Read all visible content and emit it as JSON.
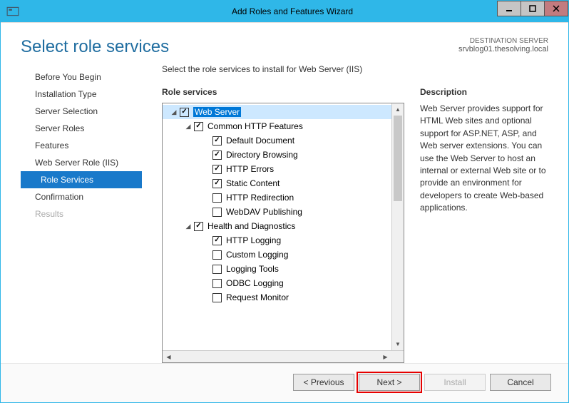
{
  "window": {
    "title": "Add Roles and Features Wizard"
  },
  "header": {
    "page_title": "Select role services",
    "dest_label": "DESTINATION SERVER",
    "dest_value": "srvblog01.thesolving.local"
  },
  "nav": {
    "items": [
      {
        "label": "Before You Begin",
        "state": "normal"
      },
      {
        "label": "Installation Type",
        "state": "normal"
      },
      {
        "label": "Server Selection",
        "state": "normal"
      },
      {
        "label": "Server Roles",
        "state": "normal"
      },
      {
        "label": "Features",
        "state": "normal"
      },
      {
        "label": "Web Server Role (IIS)",
        "state": "normal"
      },
      {
        "label": "Role Services",
        "state": "active"
      },
      {
        "label": "Confirmation",
        "state": "normal"
      },
      {
        "label": "Results",
        "state": "disabled"
      }
    ]
  },
  "main": {
    "instruction": "Select the role services to install for Web Server (IIS)",
    "services_title": "Role services",
    "desc_title": "Description",
    "desc_text": "Web Server provides support for HTML Web sites and optional support for ASP.NET, ASP, and Web server extensions. You can use the Web Server to host an internal or external Web site or to provide an environment for developers to create Web-based applications.",
    "tree": [
      {
        "label": "Web Server",
        "checked": true,
        "indent": 1,
        "expander": "▢◣",
        "selected": true
      },
      {
        "label": "Common HTTP Features",
        "checked": true,
        "indent": 2,
        "expander": "◢"
      },
      {
        "label": "Default Document",
        "checked": true,
        "indent": 3
      },
      {
        "label": "Directory Browsing",
        "checked": true,
        "indent": 3
      },
      {
        "label": "HTTP Errors",
        "checked": true,
        "indent": 3
      },
      {
        "label": "Static Content",
        "checked": true,
        "indent": 3
      },
      {
        "label": "HTTP Redirection",
        "checked": false,
        "indent": 3
      },
      {
        "label": "WebDAV Publishing",
        "checked": false,
        "indent": 3
      },
      {
        "label": "Health and Diagnostics",
        "checked": true,
        "indent": 2,
        "expander": "◢"
      },
      {
        "label": "HTTP Logging",
        "checked": true,
        "indent": 3
      },
      {
        "label": "Custom Logging",
        "checked": false,
        "indent": 3
      },
      {
        "label": "Logging Tools",
        "checked": false,
        "indent": 3
      },
      {
        "label": "ODBC Logging",
        "checked": false,
        "indent": 3
      },
      {
        "label": "Request Monitor",
        "checked": false,
        "indent": 3
      }
    ]
  },
  "footer": {
    "previous": "< Previous",
    "next": "Next >",
    "install": "Install",
    "cancel": "Cancel"
  }
}
